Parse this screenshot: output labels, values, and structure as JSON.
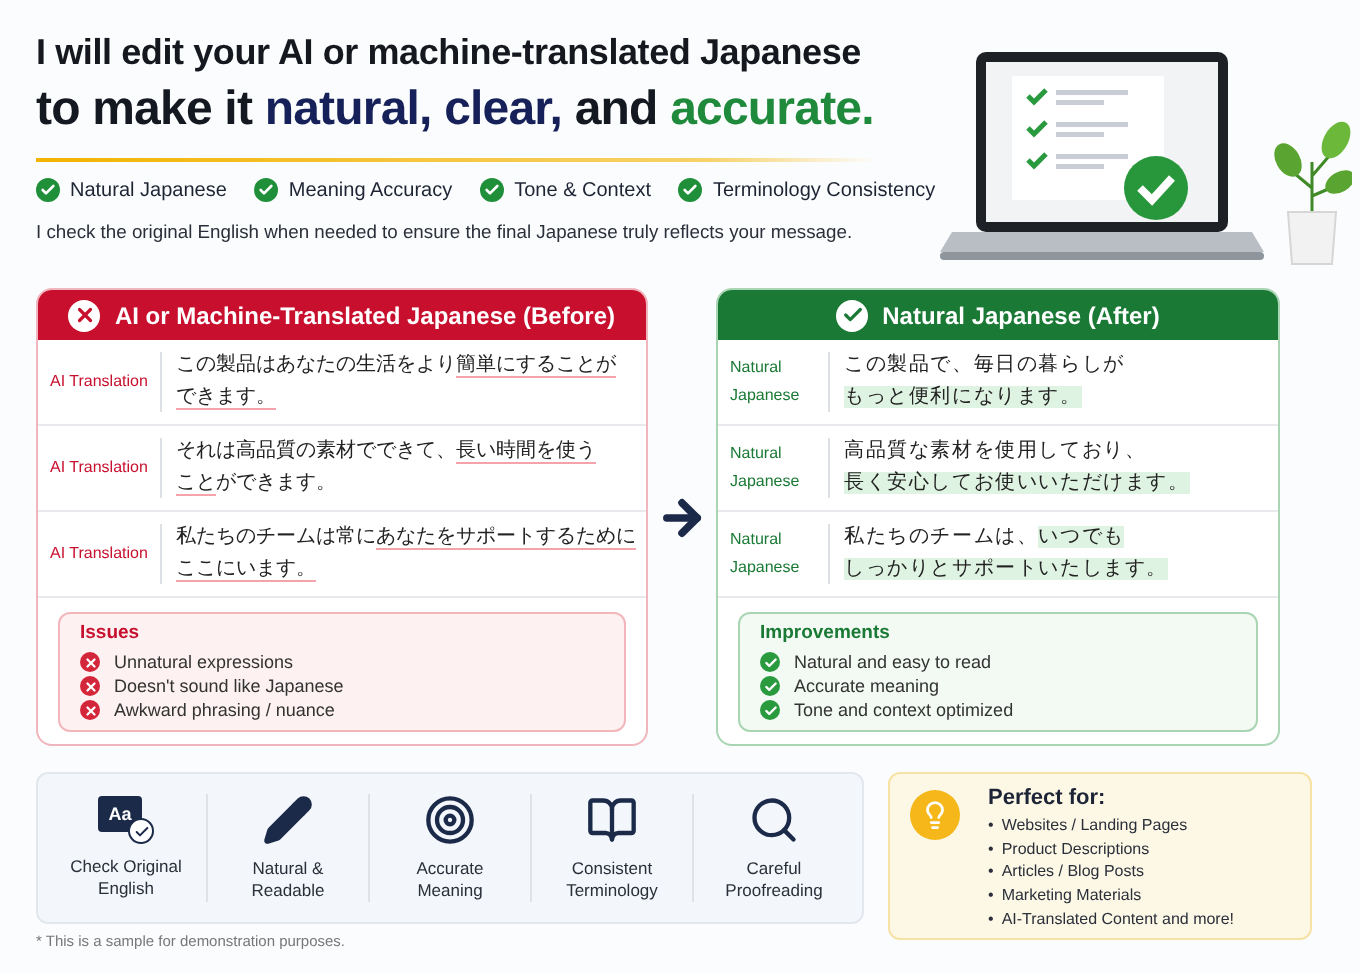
{
  "header": {
    "title_line1": "I will edit your AI or machine-translated Japanese",
    "title_line2": [
      {
        "text": "to make it ",
        "color": "#141821"
      },
      {
        "text": "natural, clear,",
        "color": "#16215a"
      },
      {
        "text": " and ",
        "color": "#141821"
      },
      {
        "text": "accurate.",
        "color": "#1f8a3b"
      }
    ],
    "checks": [
      "Natural Japanese",
      "Meaning Accuracy",
      "Tone & Context",
      "Terminology Consistency"
    ],
    "subtitle": "I check the original English when needed to ensure the final Japanese truly reflects your message."
  },
  "before": {
    "title": "AI or Machine-Translated Japanese (Before)",
    "rows": [
      {
        "label": "AI Translation",
        "lines": [
          [
            {
              "text": "この製品はあなたの生活をより",
              "marked": false
            },
            {
              "text": "簡単にすることが",
              "marked": true
            }
          ],
          [
            {
              "text": "できます。",
              "marked": true
            }
          ]
        ]
      },
      {
        "label": "AI Translation",
        "lines": [
          [
            {
              "text": "それは高品質の素材でできて、",
              "marked": false
            },
            {
              "text": "長い時間を使う",
              "marked": true
            }
          ],
          [
            {
              "text": "こと",
              "marked": true
            },
            {
              "text": "ができます。",
              "marked": false
            }
          ]
        ]
      },
      {
        "label": "AI Translation",
        "lines": [
          [
            {
              "text": "私たちのチームは常に",
              "marked": false
            },
            {
              "text": "あなたをサポートするために",
              "marked": true
            }
          ],
          [
            {
              "text": "ここにいます。",
              "marked": true
            }
          ]
        ]
      }
    ],
    "notes_title": "Issues",
    "notes": [
      "Unnatural expressions",
      "Doesn't sound like Japanese",
      "Awkward phrasing / nuance"
    ]
  },
  "after": {
    "title": "Natural Japanese (After)",
    "rows": [
      {
        "label": "Natural Japanese",
        "lines": [
          [
            {
              "text": "この製品で、毎日の暮らしが",
              "marked": false
            }
          ],
          [
            {
              "text": "もっと便利になります。",
              "marked": true
            }
          ]
        ]
      },
      {
        "label": "Natural Japanese",
        "lines": [
          [
            {
              "text": "高品質な素材を使用しており、",
              "marked": false
            }
          ],
          [
            {
              "text": "長く安心してお使いいただけます。",
              "marked": true
            }
          ]
        ]
      },
      {
        "label": "Natural Japanese",
        "lines": [
          [
            {
              "text": "私たちのチームは、",
              "marked": false
            },
            {
              "text": "いつでも",
              "marked": true
            }
          ],
          [
            {
              "text": "しっかりとサポートいたします。",
              "marked": true
            }
          ]
        ]
      }
    ],
    "notes_title": "Improvements",
    "notes": [
      "Natural and easy to read",
      "Accurate meaning",
      "Tone and context optimized"
    ]
  },
  "features": [
    {
      "kind": "letters",
      "badge": "Aa",
      "label": "Check Original English"
    },
    {
      "kind": "pencil",
      "label": "Natural & Readable"
    },
    {
      "kind": "target",
      "label": "Accurate Meaning"
    },
    {
      "kind": "book",
      "label": "Consistent Terminology"
    },
    {
      "kind": "search",
      "label": "Careful Proofreading"
    }
  ],
  "perfect_for": {
    "title": "Perfect for:",
    "bullet": "•",
    "items": [
      "Websites / Landing Pages",
      "Product Descriptions",
      "Articles / Blog Posts",
      "Marketing Materials",
      "AI-Translated Content and more!"
    ]
  },
  "footnote": "* This is a sample for demonstration purposes."
}
